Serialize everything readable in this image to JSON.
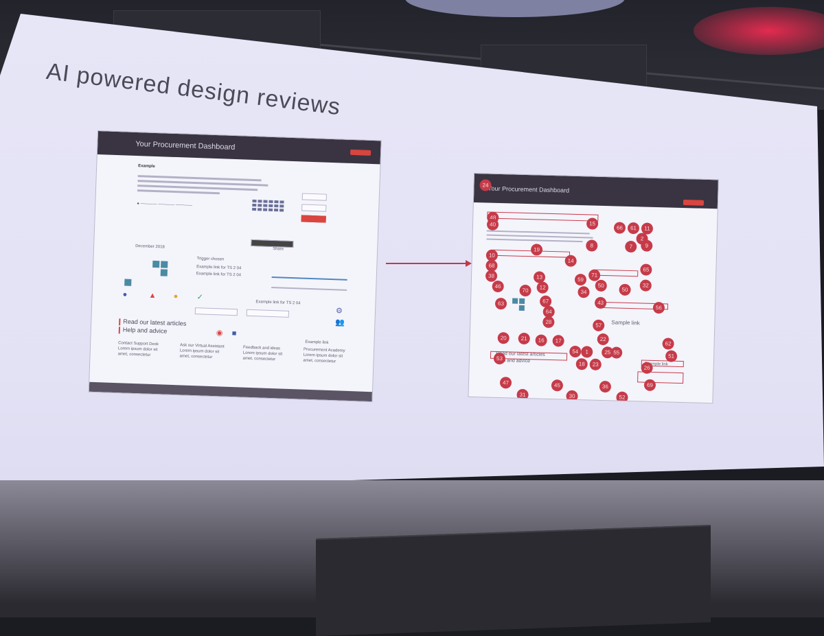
{
  "slide": {
    "title": "AI powered design reviews"
  },
  "left_mockup": {
    "header_title": "Your Procurement Dashboard",
    "heading": "Example",
    "example_link_1": "Example link for TS 2 04",
    "example_link_2": "Example link for TS 2 04",
    "share_label": "Share",
    "trigger_label": "Trigger chosen",
    "calendar_label": "December 2018",
    "example_link_text": "Example link for TS 2 04",
    "articles_title": "Read our latest articles",
    "help_title": "Help and advice",
    "example_link_small": "Example link",
    "cards": [
      {
        "title": "Contact Support Desk",
        "body": "Lorem ipsum dolor sit",
        "body2": "amet, consectetur"
      },
      {
        "title": "Ask our Virtual Assistant",
        "body": "Lorem ipsum dolor sit",
        "body2": "amet, consectetur"
      },
      {
        "title": "Feedback and ideas",
        "body": "Lorem ipsum dolor sit",
        "body2": "amet, consectetur"
      },
      {
        "title": "Procurement Academy",
        "body": "Lorem ipsum dolor sit",
        "body2": "amet, consectetur"
      }
    ],
    "status_icons": [
      "info-icon",
      "warning-icon",
      "alert-icon",
      "check-icon"
    ]
  },
  "right_mockup": {
    "header_title": "Your Procurement Dashboard",
    "articles_title": "Read our latest articles",
    "help_title": "Help and advice",
    "sample_link": "Sample link",
    "example_link": "Example link",
    "markers": [
      "24",
      "48",
      "15",
      "66",
      "61",
      "11",
      "40",
      "2",
      "9",
      "8",
      "7",
      "19",
      "10",
      "14",
      "68",
      "13",
      "71",
      "65",
      "38",
      "59",
      "50",
      "12",
      "32",
      "34",
      "46",
      "70",
      "50",
      "63",
      "67",
      "43",
      "56",
      "64",
      "28",
      "57",
      "20",
      "21",
      "16",
      "17",
      "22",
      "62",
      "54",
      "1",
      "25",
      "55",
      "51",
      "53",
      "18",
      "23",
      "26",
      "47",
      "45",
      "36",
      "69",
      "31",
      "30",
      "52"
    ]
  },
  "colors": {
    "header_bg": "#3a3442",
    "accent_red": "#d9453f",
    "marker_red": "#c63b49",
    "screen_bg": "#e4e3f6"
  }
}
